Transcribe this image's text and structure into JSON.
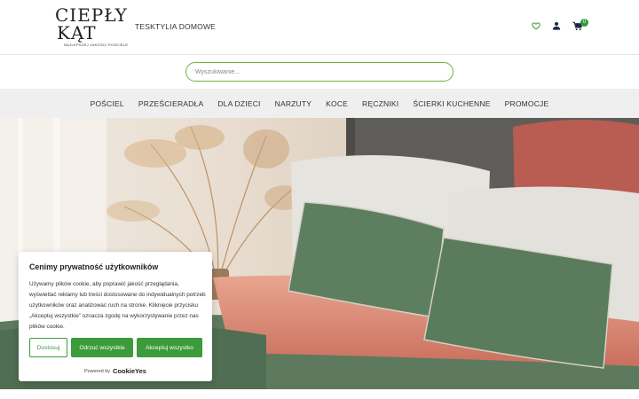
{
  "brand": {
    "logo_line1": "CIEPŁY",
    "logo_line2": "KĄT",
    "tagline": "NAJLEPSZEJ JAKOŚCI POŚCIELE"
  },
  "header": {
    "top_link": "TESKTYLIA DOMOWE",
    "cart_count": "0",
    "icons": [
      "heart-icon",
      "user-icon",
      "cart-icon"
    ]
  },
  "search": {
    "placeholder": "Wyszukiwanie..."
  },
  "nav": {
    "items": [
      {
        "label": "POŚCIEL"
      },
      {
        "label": "PRZEŚCIERADŁA"
      },
      {
        "label": "DLA DZIECI"
      },
      {
        "label": "NARZUTY"
      },
      {
        "label": "KOCE"
      },
      {
        "label": "RĘCZNIKI"
      },
      {
        "label": "ŚCIERKI KUCHENNE"
      },
      {
        "label": "PROMOCJE"
      }
    ]
  },
  "cookie": {
    "title": "Cenimy prywatność użytkowników",
    "text": "Używamy plików cookie, aby poprawić jakość przeglądania, wyświetlać reklamy lub treści dostosowane do indywidualnych potrzeb użytkowników oraz analizować ruch na stronie. Kliknięcie przycisku „Akceptuj wszystkie” oznacza zgodę na wykorzystywanie przez nas plików cookie.",
    "customize_label": "Dostosuj",
    "reject_label": "Odrzuć wszystkie",
    "accept_label": "Akceptuj wszystko",
    "powered_by": "Powered by",
    "powered_brand": "CookieYes"
  },
  "colors": {
    "accent_green": "#3c9b3a",
    "search_border": "#6cb33f",
    "nav_bg": "#efefef"
  }
}
